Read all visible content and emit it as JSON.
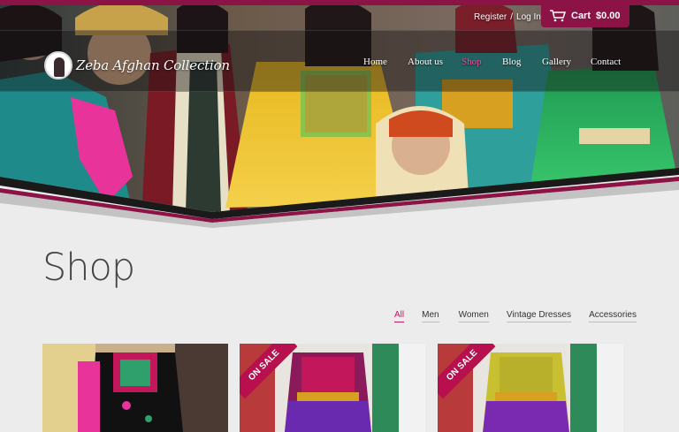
{
  "brand": {
    "name": "Zeba Afghan Collection"
  },
  "header": {
    "register_label": "Register",
    "separator": "/",
    "login_label": "Log In",
    "cart_label": "Cart",
    "cart_total": "$0.00"
  },
  "nav": {
    "items": [
      {
        "label": "Home",
        "active": false
      },
      {
        "label": "About us",
        "active": false
      },
      {
        "label": "Shop",
        "active": true
      },
      {
        "label": "Blog",
        "active": false
      },
      {
        "label": "Gallery",
        "active": false
      },
      {
        "label": "Contact",
        "active": false
      }
    ]
  },
  "page": {
    "title": "Shop"
  },
  "filters": {
    "items": [
      {
        "label": "All",
        "active": true
      },
      {
        "label": "Men",
        "active": false
      },
      {
        "label": "Women",
        "active": false
      },
      {
        "label": "Vintage Dresses",
        "active": false
      },
      {
        "label": "Accessories",
        "active": false
      }
    ]
  },
  "products": [
    {
      "badge": ""
    },
    {
      "badge": "ON SALE"
    },
    {
      "badge": "ON SALE"
    }
  ],
  "colors": {
    "accent": "#8c1346",
    "active_link": "#e0559a",
    "filter_active": "#c2185b",
    "page_bg": "#ececec"
  }
}
